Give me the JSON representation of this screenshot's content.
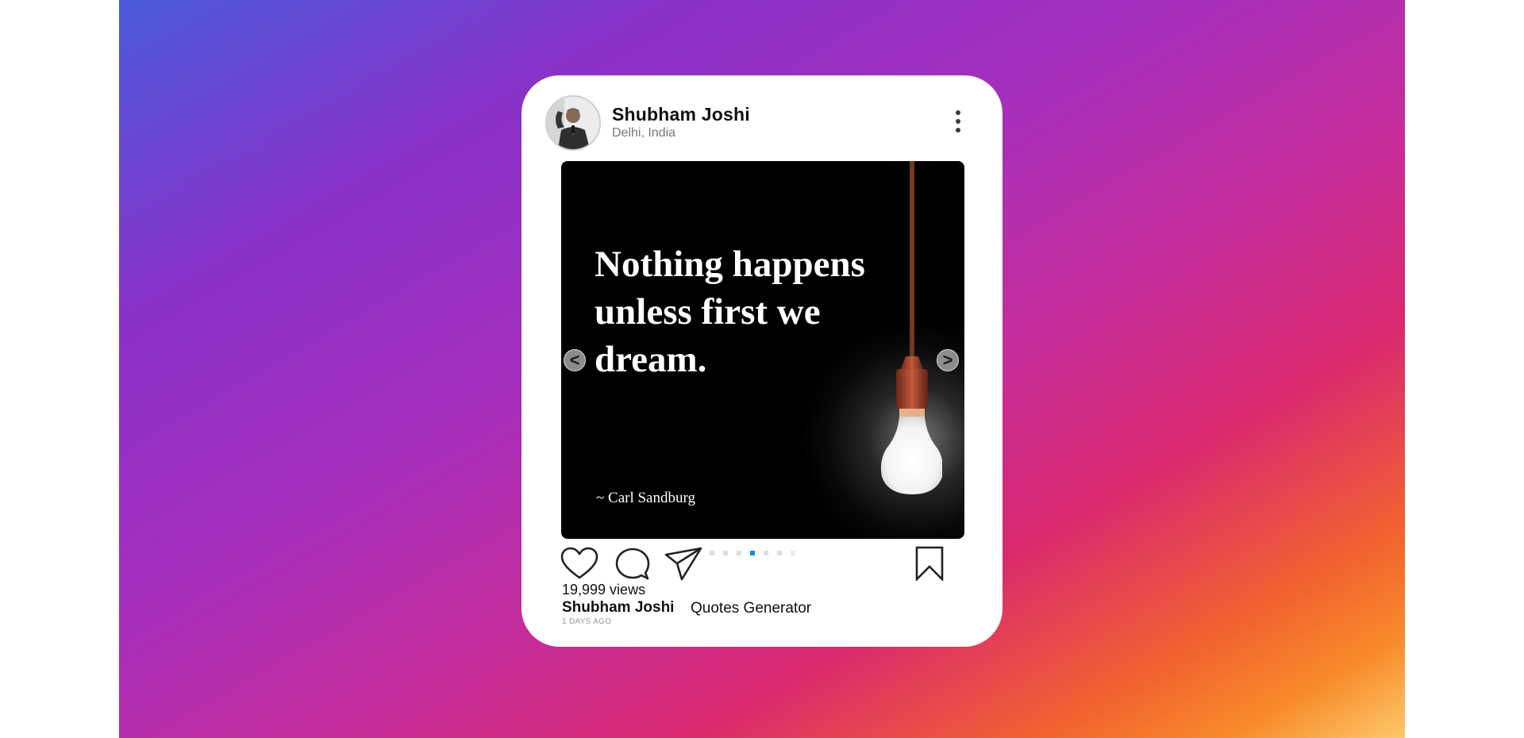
{
  "post": {
    "user_name": "Shubham Joshi",
    "location": "Delhi, India",
    "avatar_icon": "user-avatar-photo",
    "more_icon": "more-vertical-icon"
  },
  "slide": {
    "quote": "Nothing happens unless first we dream.",
    "author": "~ Carl Sandburg",
    "prev_label": "<",
    "next_label": ">",
    "image_icon": "light-bulb-icon",
    "total_slides": 7,
    "active_slide": 4
  },
  "actions": {
    "like_icon": "heart-icon",
    "comment_icon": "comment-icon",
    "share_icon": "send-icon",
    "save_icon": "bookmark-icon"
  },
  "footer": {
    "views": "19,999 views",
    "caption_user": "Shubham Joshi",
    "caption_text": "Quotes Generator",
    "time_ago": "1 DAYS AGO"
  },
  "colors": {
    "accent": "#1a8ad0",
    "card": "#ffffff",
    "gradient_start": "#4a5bdb",
    "gradient_mid": "#c52d9c",
    "gradient_end": "#fdc96a"
  }
}
